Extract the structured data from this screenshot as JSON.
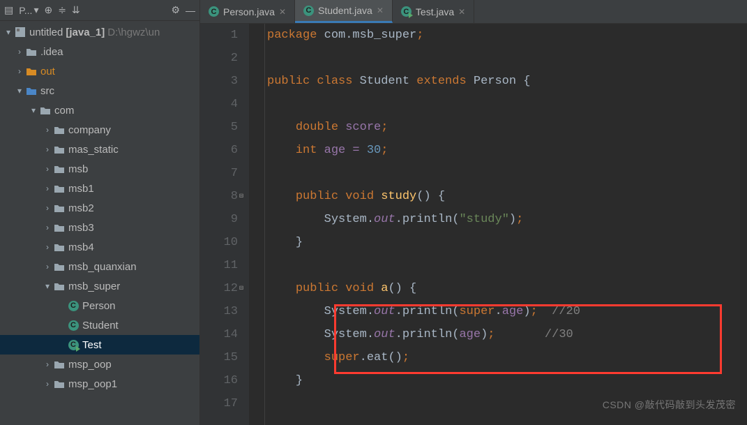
{
  "toolbar": {
    "project_label": "P..."
  },
  "tree": {
    "root": {
      "name": "untitled",
      "module": "[java_1]",
      "path": "D:\\hgwz\\un"
    },
    "idea": ".idea",
    "out": "out",
    "src": "src",
    "com": "com",
    "pkgs": [
      "company",
      "mas_static",
      "msb",
      "msb1",
      "msb2",
      "msb3",
      "msb4",
      "msb_quanxian",
      "msb_super"
    ],
    "classes": [
      "Person",
      "Student",
      "Test"
    ],
    "pkgs_tail": [
      "msp_oop",
      "msp_oop1"
    ]
  },
  "tabs": [
    {
      "label": "Person.java",
      "active": false
    },
    {
      "label": "Student.java",
      "active": true
    },
    {
      "label": "Test.java",
      "active": false
    }
  ],
  "code_lines": [
    "1",
    "2",
    "3",
    "4",
    "5",
    "6",
    "7",
    "8",
    "9",
    "10",
    "11",
    "12",
    "13",
    "14",
    "15",
    "16",
    "17"
  ],
  "code": {
    "l1_kw": "package",
    "l1_pkg": " com.msb_super",
    "l1_semi": ";",
    "l3_kw1": "public class ",
    "l3_cls": "Student ",
    "l3_kw2": "extends ",
    "l3_sup": "Person {",
    "l5_kw": "double ",
    "l5_id": "score",
    "l5_semi": ";",
    "l6_kw": "int ",
    "l6_id": "age = ",
    "l6_num": "30",
    "l6_semi": ";",
    "l8_kw": "public void ",
    "l8_fn": "study",
    "l8_rest": "() {",
    "l9_sys": "System.",
    "l9_out": "out",
    "l9_fn": ".println(",
    "l9_str": "\"study\"",
    "l9_end": ")",
    "l9_semi": ";",
    "l10_brace": "}",
    "l12_kw": "public void ",
    "l12_fn": "a",
    "l12_rest": "() {",
    "l13_sys": "System.",
    "l13_out": "out",
    "l13_fn": ".println(",
    "l13_kw": "super",
    "l13_dot": ".",
    "l13_fld": "age",
    "l13_end": ")",
    "l13_semi": ";",
    "l13_com": "  //20",
    "l14_sys": "System.",
    "l14_out": "out",
    "l14_fn": ".println(",
    "l14_fld": "age",
    "l14_end": ")",
    "l14_semi": ";",
    "l14_com": "       //30",
    "l15_kw": "super",
    "l15_rest": ".eat()",
    "l15_semi": ";",
    "l16_brace": "}"
  },
  "watermark": "CSDN @敲代码敲到头发茂密"
}
